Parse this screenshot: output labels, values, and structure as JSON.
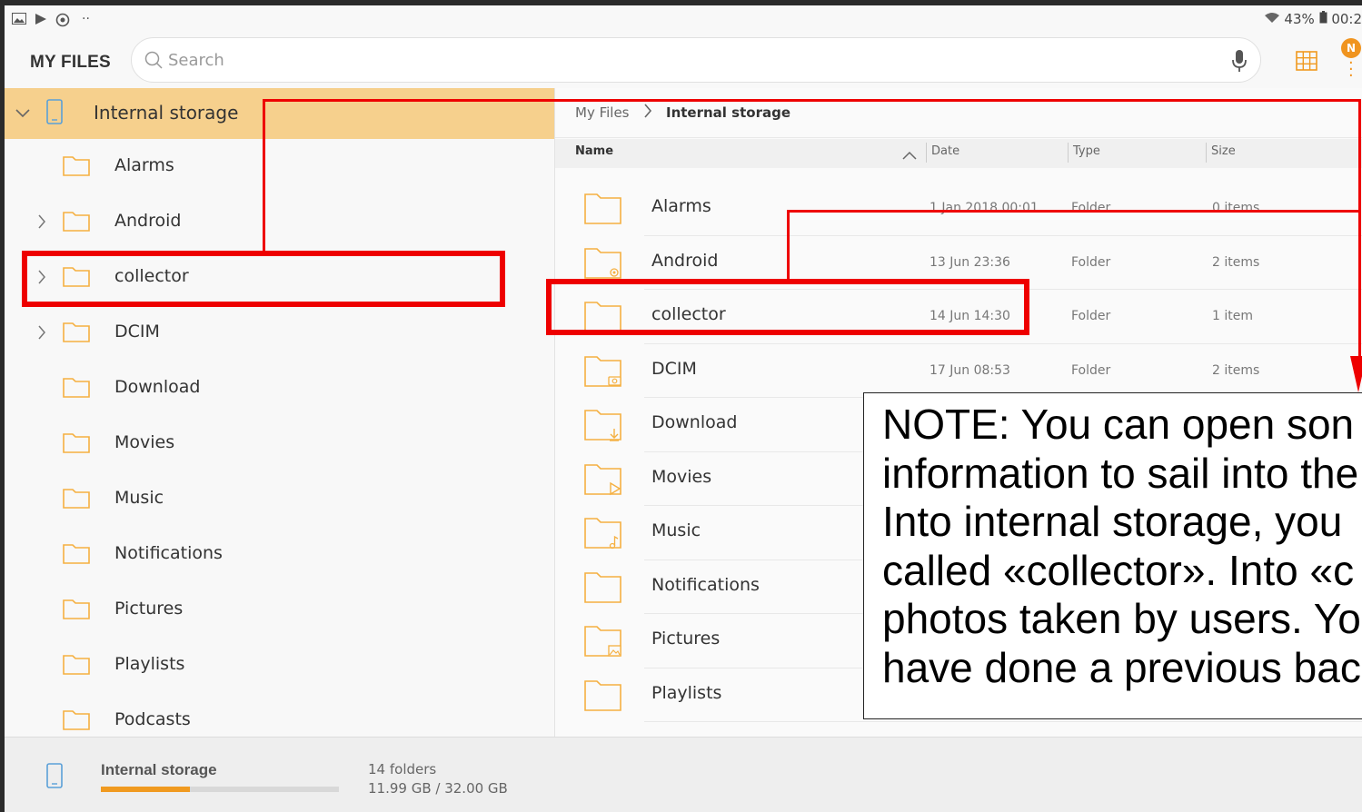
{
  "status_bar": {
    "battery": "43%",
    "time": "00:2"
  },
  "header": {
    "app_title": "MY FILES",
    "search_placeholder": "Search",
    "notification_badge": "N"
  },
  "tree": {
    "root_label": "Internal storage",
    "items": [
      {
        "label": "Alarms",
        "expandable": false
      },
      {
        "label": "Android",
        "expandable": true
      },
      {
        "label": "collector",
        "expandable": true
      },
      {
        "label": "DCIM",
        "expandable": true
      },
      {
        "label": "Download",
        "expandable": false
      },
      {
        "label": "Movies",
        "expandable": false
      },
      {
        "label": "Music",
        "expandable": false
      },
      {
        "label": "Notifications",
        "expandable": false
      },
      {
        "label": "Pictures",
        "expandable": false
      },
      {
        "label": "Playlists",
        "expandable": false
      },
      {
        "label": "Podcasts",
        "expandable": false
      }
    ]
  },
  "breadcrumb": {
    "root": "My Files",
    "current": "Internal storage"
  },
  "columns": {
    "name": "Name",
    "date": "Date",
    "type": "Type",
    "size": "Size"
  },
  "files": [
    {
      "name": "Alarms",
      "date": "1 Jan 2018 00:01",
      "type": "Folder",
      "size": "0 items",
      "icon": "folder"
    },
    {
      "name": "Android",
      "date": "13 Jun 23:36",
      "type": "Folder",
      "size": "2 items",
      "icon": "settings-folder"
    },
    {
      "name": "collector",
      "date": "14 Jun 14:30",
      "type": "Folder",
      "size": "1 item",
      "icon": "folder"
    },
    {
      "name": "DCIM",
      "date": "17 Jun 08:53",
      "type": "Folder",
      "size": "2 items",
      "icon": "camera-folder"
    },
    {
      "name": "Download",
      "date": "",
      "type": "",
      "size": "",
      "icon": "download-folder"
    },
    {
      "name": "Movies",
      "date": "",
      "type": "",
      "size": "",
      "icon": "video-folder"
    },
    {
      "name": "Music",
      "date": "",
      "type": "",
      "size": "",
      "icon": "music-folder"
    },
    {
      "name": "Notifications",
      "date": "",
      "type": "",
      "size": "",
      "icon": "folder"
    },
    {
      "name": "Pictures",
      "date": "",
      "type": "",
      "size": "",
      "icon": "image-folder"
    },
    {
      "name": "Playlists",
      "date": "",
      "type": "",
      "size": "",
      "icon": "folder"
    }
  ],
  "storage": {
    "label": "Internal storage",
    "folders": "14 folders",
    "usage": "11.99 GB / 32.00 GB",
    "used_fraction": 0.375
  },
  "note": {
    "lines": [
      "NOTE: You can open son",
      "information to sail into the",
      "Into internal storage, you",
      "called «collector». Into «c",
      "photos taken by users. Yo",
      "have done a previous bac"
    ]
  },
  "colors": {
    "accent": "#f09a20",
    "selection": "#f6d08d",
    "annotation": "#ee0000",
    "folder_icon": "#f5b041"
  }
}
